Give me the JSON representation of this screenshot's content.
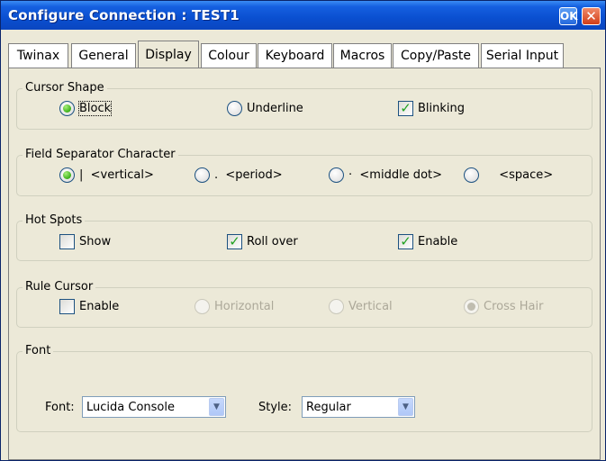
{
  "window": {
    "title": "Configure Connection : TEST1",
    "ok_label": "OK",
    "close_label": "✕"
  },
  "tabs": [
    "Twinax",
    "General",
    "Display",
    "Colour",
    "Keyboard",
    "Macros",
    "Copy/Paste",
    "Serial Input"
  ],
  "active_tab": "Display",
  "cursor_shape": {
    "label": "Cursor Shape",
    "block": "Block",
    "underline": "Underline",
    "blinking": "Blinking",
    "selected": "Block",
    "blinking_checked": true
  },
  "field_separator": {
    "label": "Field Separator Character",
    "options": [
      "|  <vertical>",
      ".  <period>",
      "·  <middle dot>",
      "  <space>"
    ],
    "selected_index": 0
  },
  "hot_spots": {
    "label": "Hot Spots",
    "show": "Show",
    "roll_over": "Roll over",
    "enable": "Enable",
    "show_checked": false,
    "roll_over_checked": true,
    "enable_checked": true
  },
  "rule_cursor": {
    "label": "Rule Cursor",
    "enable": "Enable",
    "horizontal": "Horizontal",
    "vertical": "Vertical",
    "cross_hair": "Cross Hair",
    "enable_checked": false,
    "selected": "Cross Hair"
  },
  "font": {
    "label": "Font",
    "font_label": "Font:",
    "font_value": "Lucida Console",
    "style_label": "Style:",
    "style_value": "Regular"
  },
  "icons": {
    "check": "✓",
    "dropdown": "▼"
  }
}
